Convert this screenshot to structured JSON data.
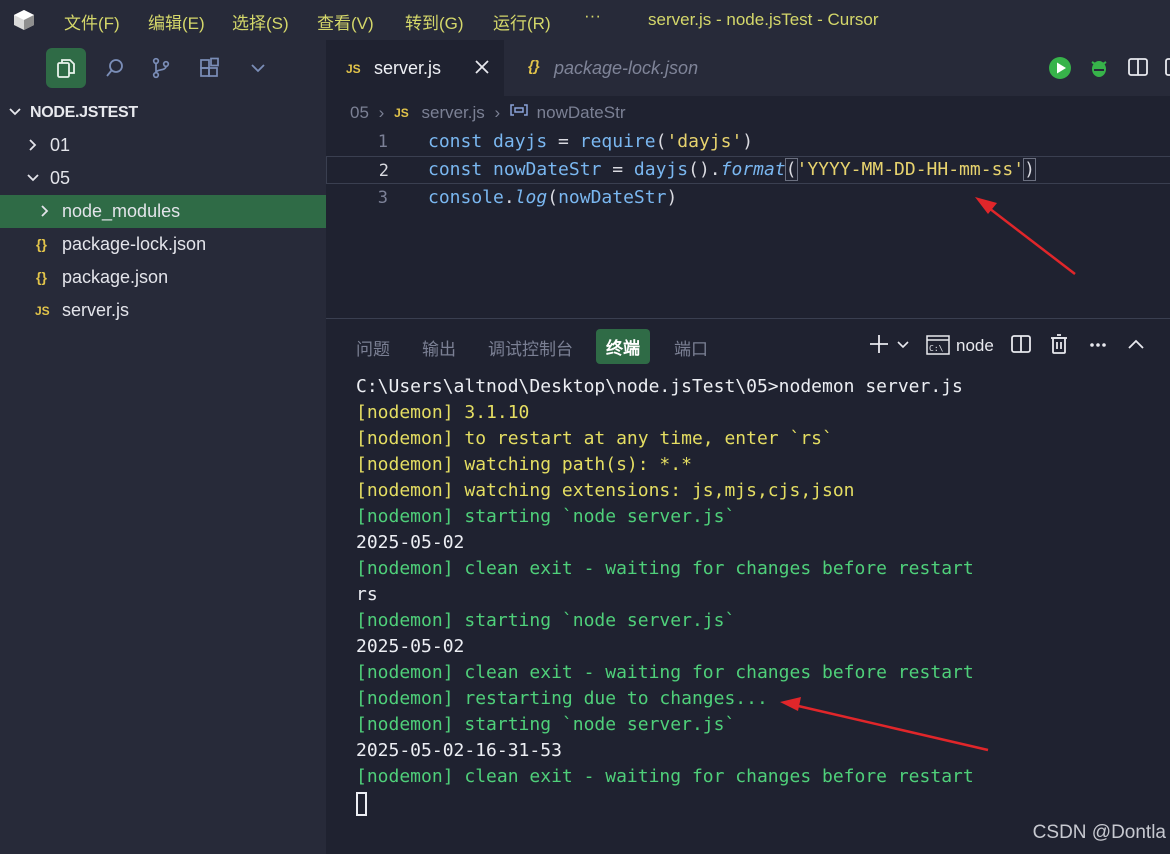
{
  "titlebar": {
    "menus": [
      "文件(F)",
      "编辑(E)",
      "选择(S)",
      "查看(V)",
      "转到(G)",
      "运行(R)",
      "···"
    ],
    "window_title": "server.js - node.jsTest - Cursor"
  },
  "activity_icons": [
    "files-icon",
    "search-icon",
    "source-control-icon",
    "extensions-icon",
    "chevron-down-icon"
  ],
  "explorer": {
    "title": "NODE.JSTEST",
    "items": [
      {
        "label": "01",
        "type": "folder",
        "expanded": false
      },
      {
        "label": "05",
        "type": "folder",
        "expanded": true
      },
      {
        "label": "node_modules",
        "type": "folder",
        "expanded": false,
        "selected": true
      },
      {
        "label": "package-lock.json",
        "type": "json"
      },
      {
        "label": "package.json",
        "type": "json"
      },
      {
        "label": "server.js",
        "type": "js"
      }
    ],
    "json_glyph": "{}",
    "js_glyph": "JS"
  },
  "tabs": [
    {
      "label": "server.js",
      "icon": "JS",
      "active": true
    },
    {
      "label": "package-lock.json",
      "icon": "{}",
      "active": false
    }
  ],
  "breadcrumb": {
    "folder": "05",
    "file_icon": "JS",
    "file": "server.js",
    "symbol": "nowDateStr"
  },
  "code": {
    "line_numbers": [
      "1",
      "2",
      "3"
    ],
    "l1": {
      "kw": "const",
      "name": "dayjs",
      "eq": " = ",
      "fn": "require",
      "open": "(",
      "str": "'dayjs'",
      "close": ")"
    },
    "l2": {
      "kw": "const",
      "name": "nowDateStr",
      "eq": " = ",
      "fn": "dayjs",
      "call": "().",
      "method": "format",
      "open": "(",
      "str": "'YYYY-MM-DD-HH-mm-ss'",
      "close": ")"
    },
    "l3": {
      "obj": "console",
      "dot": ".",
      "method": "log",
      "open": "(",
      "arg": "nowDateStr",
      "close": ")"
    }
  },
  "panel": {
    "tabs": [
      "问题",
      "输出",
      "调试控制台",
      "终端",
      "端口"
    ],
    "active_tab": "终端",
    "terminal_profile": "node"
  },
  "terminal": {
    "lines": [
      {
        "text": "C:\\Users\\altnod\\Desktop\\node.jsTest\\05>nodemon server.js",
        "color": "white"
      },
      {
        "text": "[nodemon] 3.1.10",
        "color": "yellow"
      },
      {
        "text": "[nodemon] to restart at any time, enter `rs`",
        "color": "yellow"
      },
      {
        "text": "[nodemon] watching path(s): *.*",
        "color": "yellow"
      },
      {
        "text": "[nodemon] watching extensions: js,mjs,cjs,json",
        "color": "yellow"
      },
      {
        "text": "[nodemon] starting `node server.js`",
        "color": "green"
      },
      {
        "text": "2025-05-02",
        "color": "white"
      },
      {
        "text": "[nodemon] clean exit - waiting for changes before restart",
        "color": "green"
      },
      {
        "text": "rs",
        "color": "white"
      },
      {
        "text": "[nodemon] starting `node server.js`",
        "color": "green"
      },
      {
        "text": "2025-05-02",
        "color": "white"
      },
      {
        "text": "[nodemon] clean exit - waiting for changes before restart",
        "color": "green"
      },
      {
        "text": "[nodemon] restarting due to changes...",
        "color": "green"
      },
      {
        "text": "[nodemon] starting `node server.js`",
        "color": "green"
      },
      {
        "text": "2025-05-02-16-31-53",
        "color": "white"
      },
      {
        "text": "[nodemon] clean exit - waiting for changes before restart",
        "color": "green"
      }
    ]
  },
  "watermark": "CSDN @Dontla",
  "colors": {
    "accent_green": "#2f6b46",
    "annotation_arrow": "#e0262a",
    "terminal_yellow": "#e5de62",
    "terminal_green": "#4fd07a"
  }
}
